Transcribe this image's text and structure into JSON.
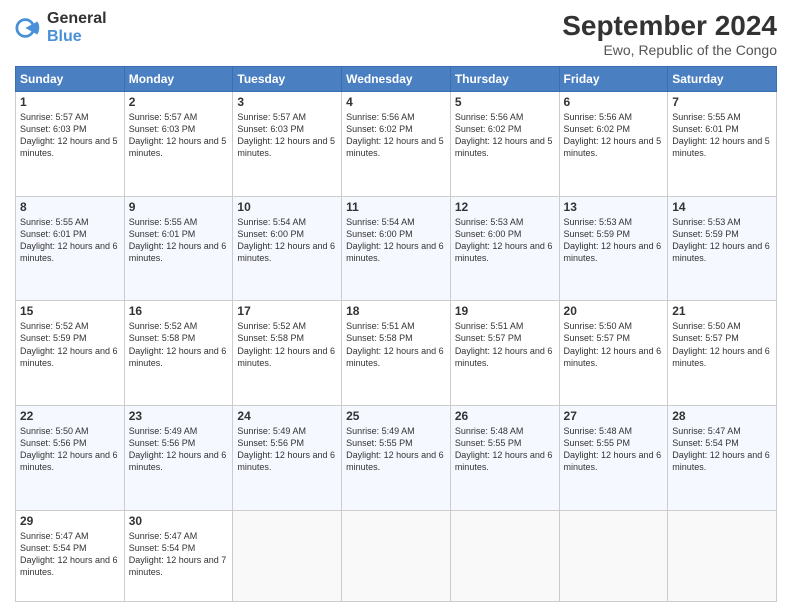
{
  "logo": {
    "line1": "General",
    "line2": "Blue"
  },
  "title": "September 2024",
  "location": "Ewo, Republic of the Congo",
  "days_of_week": [
    "Sunday",
    "Monday",
    "Tuesday",
    "Wednesday",
    "Thursday",
    "Friday",
    "Saturday"
  ],
  "weeks": [
    [
      {
        "day": "1",
        "sunrise": "5:57 AM",
        "sunset": "6:03 PM",
        "daylight": "12 hours and 5 minutes."
      },
      {
        "day": "2",
        "sunrise": "5:57 AM",
        "sunset": "6:03 PM",
        "daylight": "12 hours and 5 minutes."
      },
      {
        "day": "3",
        "sunrise": "5:57 AM",
        "sunset": "6:03 PM",
        "daylight": "12 hours and 5 minutes."
      },
      {
        "day": "4",
        "sunrise": "5:56 AM",
        "sunset": "6:02 PM",
        "daylight": "12 hours and 5 minutes."
      },
      {
        "day": "5",
        "sunrise": "5:56 AM",
        "sunset": "6:02 PM",
        "daylight": "12 hours and 5 minutes."
      },
      {
        "day": "6",
        "sunrise": "5:56 AM",
        "sunset": "6:02 PM",
        "daylight": "12 hours and 5 minutes."
      },
      {
        "day": "7",
        "sunrise": "5:55 AM",
        "sunset": "6:01 PM",
        "daylight": "12 hours and 5 minutes."
      }
    ],
    [
      {
        "day": "8",
        "sunrise": "5:55 AM",
        "sunset": "6:01 PM",
        "daylight": "12 hours and 6 minutes."
      },
      {
        "day": "9",
        "sunrise": "5:55 AM",
        "sunset": "6:01 PM",
        "daylight": "12 hours and 6 minutes."
      },
      {
        "day": "10",
        "sunrise": "5:54 AM",
        "sunset": "6:00 PM",
        "daylight": "12 hours and 6 minutes."
      },
      {
        "day": "11",
        "sunrise": "5:54 AM",
        "sunset": "6:00 PM",
        "daylight": "12 hours and 6 minutes."
      },
      {
        "day": "12",
        "sunrise": "5:53 AM",
        "sunset": "6:00 PM",
        "daylight": "12 hours and 6 minutes."
      },
      {
        "day": "13",
        "sunrise": "5:53 AM",
        "sunset": "5:59 PM",
        "daylight": "12 hours and 6 minutes."
      },
      {
        "day": "14",
        "sunrise": "5:53 AM",
        "sunset": "5:59 PM",
        "daylight": "12 hours and 6 minutes."
      }
    ],
    [
      {
        "day": "15",
        "sunrise": "5:52 AM",
        "sunset": "5:59 PM",
        "daylight": "12 hours and 6 minutes."
      },
      {
        "day": "16",
        "sunrise": "5:52 AM",
        "sunset": "5:58 PM",
        "daylight": "12 hours and 6 minutes."
      },
      {
        "day": "17",
        "sunrise": "5:52 AM",
        "sunset": "5:58 PM",
        "daylight": "12 hours and 6 minutes."
      },
      {
        "day": "18",
        "sunrise": "5:51 AM",
        "sunset": "5:58 PM",
        "daylight": "12 hours and 6 minutes."
      },
      {
        "day": "19",
        "sunrise": "5:51 AM",
        "sunset": "5:57 PM",
        "daylight": "12 hours and 6 minutes."
      },
      {
        "day": "20",
        "sunrise": "5:50 AM",
        "sunset": "5:57 PM",
        "daylight": "12 hours and 6 minutes."
      },
      {
        "day": "21",
        "sunrise": "5:50 AM",
        "sunset": "5:57 PM",
        "daylight": "12 hours and 6 minutes."
      }
    ],
    [
      {
        "day": "22",
        "sunrise": "5:50 AM",
        "sunset": "5:56 PM",
        "daylight": "12 hours and 6 minutes."
      },
      {
        "day": "23",
        "sunrise": "5:49 AM",
        "sunset": "5:56 PM",
        "daylight": "12 hours and 6 minutes."
      },
      {
        "day": "24",
        "sunrise": "5:49 AM",
        "sunset": "5:56 PM",
        "daylight": "12 hours and 6 minutes."
      },
      {
        "day": "25",
        "sunrise": "5:49 AM",
        "sunset": "5:55 PM",
        "daylight": "12 hours and 6 minutes."
      },
      {
        "day": "26",
        "sunrise": "5:48 AM",
        "sunset": "5:55 PM",
        "daylight": "12 hours and 6 minutes."
      },
      {
        "day": "27",
        "sunrise": "5:48 AM",
        "sunset": "5:55 PM",
        "daylight": "12 hours and 6 minutes."
      },
      {
        "day": "28",
        "sunrise": "5:47 AM",
        "sunset": "5:54 PM",
        "daylight": "12 hours and 6 minutes."
      }
    ],
    [
      {
        "day": "29",
        "sunrise": "5:47 AM",
        "sunset": "5:54 PM",
        "daylight": "12 hours and 6 minutes."
      },
      {
        "day": "30",
        "sunrise": "5:47 AM",
        "sunset": "5:54 PM",
        "daylight": "12 hours and 7 minutes."
      },
      null,
      null,
      null,
      null,
      null
    ]
  ]
}
